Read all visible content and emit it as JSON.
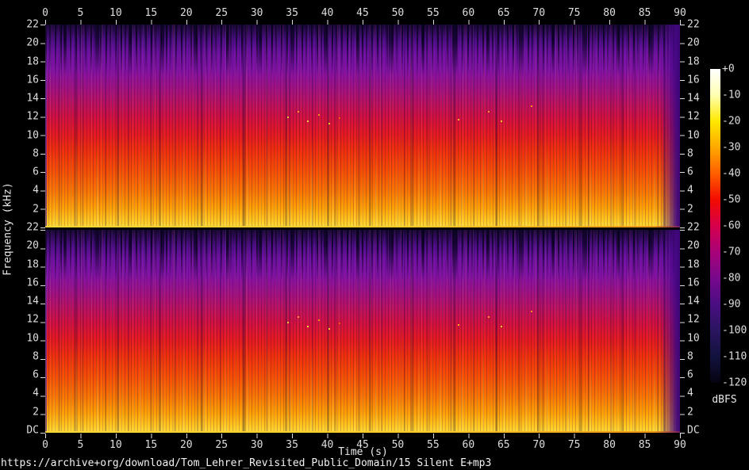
{
  "chart_data": {
    "type": "heatmap",
    "subtype": "stereo_audio_spectrogram",
    "title": "https://archive+org/download/Tom_Lehrer_Revisited_Public_Domain/15 Silent E+mp3",
    "xlabel": "Time (s)",
    "ylabel": "Frequency (kHz)",
    "colorbar_label": "dBFS",
    "channels": 2,
    "x_range_s": [
      0,
      90
    ],
    "x_ticks_s": [
      0,
      5,
      10,
      15,
      20,
      25,
      30,
      35,
      40,
      45,
      50,
      55,
      60,
      65,
      70,
      75,
      80,
      85,
      90
    ],
    "y_range_khz_per_channel": [
      0,
      22
    ],
    "y_ticks_khz": [
      22,
      20,
      18,
      16,
      14,
      12,
      10,
      8,
      6,
      4,
      2,
      0
    ],
    "colorbar_range_dbfs": [
      0,
      -120
    ],
    "colorbar_ticks_dbfs": [
      0,
      -10,
      -20,
      -30,
      -40,
      -50,
      -60,
      -70,
      -80,
      -90,
      -100,
      -110,
      -120
    ],
    "colormap": [
      {
        "db": 0,
        "color": "#ffffff"
      },
      {
        "db": -10,
        "color": "#ffffb2"
      },
      {
        "db": -20,
        "color": "#ffe800"
      },
      {
        "db": -30,
        "color": "#ffa800"
      },
      {
        "db": -40,
        "color": "#ff5e00"
      },
      {
        "db": -50,
        "color": "#f30b00"
      },
      {
        "db": -60,
        "color": "#d6004c"
      },
      {
        "db": -70,
        "color": "#a80278"
      },
      {
        "db": -80,
        "color": "#77098c"
      },
      {
        "db": -90,
        "color": "#4a0d82"
      },
      {
        "db": -100,
        "color": "#2a155f"
      },
      {
        "db": -110,
        "color": "#12123e"
      },
      {
        "db": -120,
        "color": "#050310"
      }
    ],
    "summary": "Two stacked channel spectrograms (0-90 s, DC-22 kHz each). Strong energy (yellow/orange, about -20 to -40 dBFS) below ~4 kHz, red mid band to ~10 kHz, purple/dark (-80 to -110 dBFS) above ~14 kHz, dense vertical note/percussion streaks, signal fading out near 89-90 s."
  },
  "axes": {
    "time_labels": [
      "0",
      "5",
      "10",
      "15",
      "20",
      "25",
      "30",
      "35",
      "40",
      "45",
      "50",
      "55",
      "60",
      "65",
      "70",
      "75",
      "80",
      "85",
      "90"
    ],
    "freq_labels_ch1": [
      "22",
      "20",
      "18",
      "16",
      "14",
      "12",
      "10",
      "8",
      "6",
      "4",
      "2"
    ],
    "freq_labels_ch2": [
      "22",
      "20",
      "18",
      "16",
      "14",
      "12",
      "10",
      "8",
      "6",
      "4",
      "2",
      "DC"
    ],
    "colorbar_labels": [
      "+0",
      "-10",
      "-20",
      "-30",
      "-40",
      "-50",
      "-60",
      "-70",
      "-80",
      "-90",
      "-100",
      "-110",
      "-120"
    ],
    "x_axis_title": "Time (s)",
    "y_axis_title": "Frequency (kHz)",
    "colorbar_title": "dBFS"
  },
  "footer": {
    "url_text": "https://archive+org/download/Tom_Lehrer_Revisited_Public_Domain/15 Silent E+mp3"
  }
}
